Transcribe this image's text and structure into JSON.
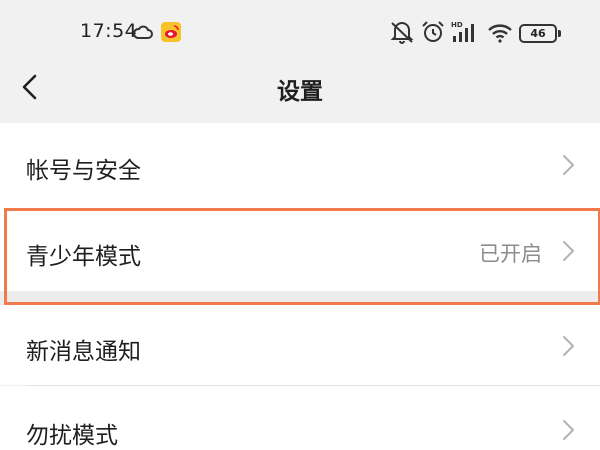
{
  "status_bar": {
    "time": "17:54",
    "battery": "46",
    "signal_label": "HD",
    "icons": [
      "cloud-icon",
      "weibo-icon",
      "mute-icon",
      "alarm-icon",
      "signal-icon",
      "wifi-icon",
      "battery-icon"
    ]
  },
  "nav": {
    "title": "设置",
    "back_icon": "chevron-left-icon"
  },
  "settings": {
    "items": [
      {
        "label": "帐号与安全",
        "value": ""
      },
      {
        "label": "青少年模式",
        "value": "已开启"
      },
      {
        "label": "新消息通知",
        "value": ""
      },
      {
        "label": "勿扰模式",
        "value": ""
      }
    ]
  },
  "colors": {
    "background": "#f1f1f1",
    "row_background": "#ffffff",
    "highlight": "#f07a4c",
    "secondary_text": "#8c8c8c"
  }
}
